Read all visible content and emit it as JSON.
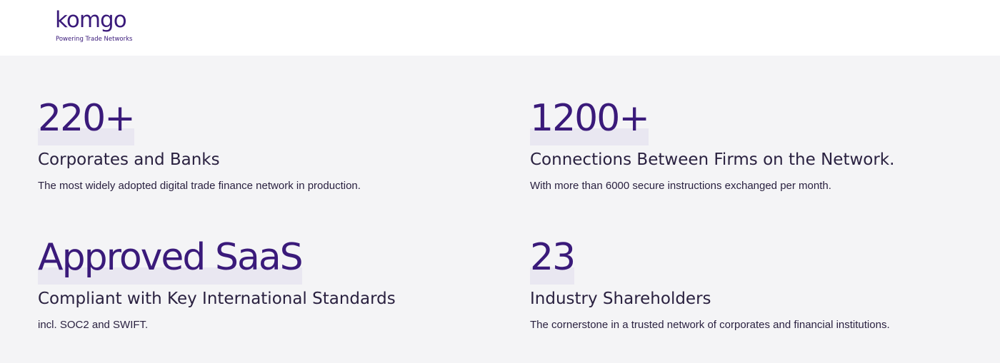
{
  "header": {
    "logo_text": "komgo",
    "tagline": "Powering Trade Networks"
  },
  "stats": [
    {
      "value": "220+",
      "title": "Corporates and Banks",
      "description": "The most widely adopted digital trade finance network in production."
    },
    {
      "value": "1200+",
      "title": "Connections Between Firms on the Network.",
      "description": "With more than 6000 secure instructions exchanged per month."
    },
    {
      "value": "Approved SaaS",
      "title": "Compliant with Key International Standards",
      "description": "incl. SOC2 and SWIFT."
    },
    {
      "value": "23",
      "title": "Industry Shareholders",
      "description": "The cornerstone in a trusted network of corporates and financial institutions."
    }
  ],
  "colors": {
    "brand_purple": "#3a1a7a",
    "text_dark": "#2a2140",
    "page_background": "#f4f4f6",
    "header_background": "#ffffff"
  }
}
